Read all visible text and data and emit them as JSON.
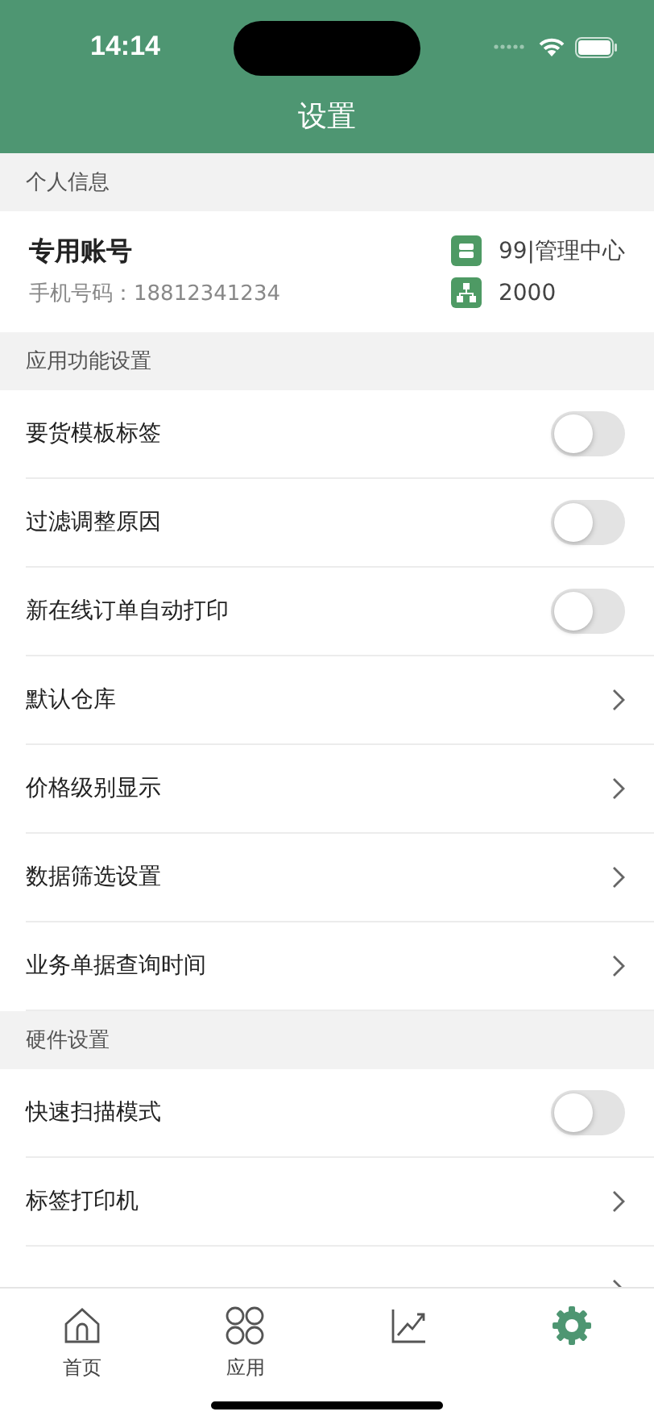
{
  "status_bar": {
    "time": "14:14"
  },
  "title": "设置",
  "sections": [
    {
      "header": "个人信息",
      "kind": "profile",
      "profile": {
        "name": "专用账号",
        "phone": "手机号码：18812341234",
        "store": "99|管理中心",
        "org": "2000"
      }
    },
    {
      "header": "应用功能设置",
      "kind": "rows",
      "rows": [
        {
          "label": "要货模板标签",
          "kind": "toggle",
          "on": false
        },
        {
          "label": "过滤调整原因",
          "kind": "toggle",
          "on": false
        },
        {
          "label": "新在线订单自动打印",
          "kind": "toggle",
          "on": false
        },
        {
          "label": "默认仓库",
          "kind": "link"
        },
        {
          "label": "价格级别显示",
          "kind": "link"
        },
        {
          "label": "数据筛选设置",
          "kind": "link"
        },
        {
          "label": "业务单据查询时间",
          "kind": "link"
        }
      ]
    },
    {
      "header": "硬件设置",
      "kind": "rows",
      "rows": [
        {
          "label": "快速扫描模式",
          "kind": "toggle",
          "on": false
        },
        {
          "label": "标签打印机",
          "kind": "link"
        },
        {
          "kind": "link"
        }
      ]
    }
  ],
  "tabs": [
    {
      "label": "首页",
      "kind": "home",
      "selected": false
    },
    {
      "label": "应用",
      "kind": "apps",
      "selected": false
    },
    {
      "kind": "chart",
      "selected": false
    },
    {
      "kind": "gear",
      "selected": true
    }
  ]
}
